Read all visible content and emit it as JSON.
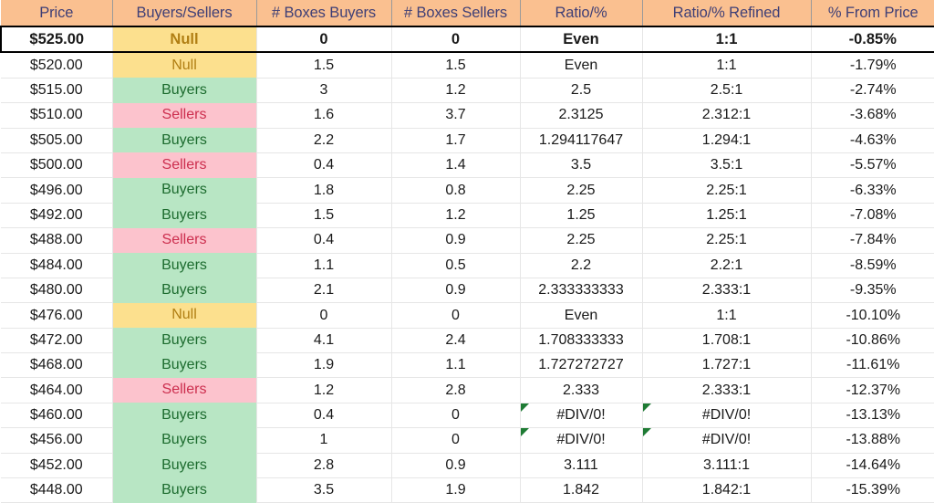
{
  "table": {
    "columns": [
      "Price",
      "Buyers/Sellers",
      "# Boxes Buyers",
      "# Boxes Sellers",
      "Ratio/%",
      "Ratio/% Refined",
      "% From Price"
    ],
    "rows": [
      {
        "price": "$525.00",
        "signal": "Null",
        "boxes_buyers": "0",
        "boxes_sellers": "0",
        "ratio": "Even",
        "ratio_refined": "1:1",
        "pct_from_price": "-0.85%",
        "highlight": true,
        "ratio_error": false
      },
      {
        "price": "$520.00",
        "signal": "Null",
        "boxes_buyers": "1.5",
        "boxes_sellers": "1.5",
        "ratio": "Even",
        "ratio_refined": "1:1",
        "pct_from_price": "-1.79%",
        "highlight": false,
        "ratio_error": false
      },
      {
        "price": "$515.00",
        "signal": "Buyers",
        "boxes_buyers": "3",
        "boxes_sellers": "1.2",
        "ratio": "2.5",
        "ratio_refined": "2.5:1",
        "pct_from_price": "-2.74%",
        "highlight": false,
        "ratio_error": false
      },
      {
        "price": "$510.00",
        "signal": "Sellers",
        "boxes_buyers": "1.6",
        "boxes_sellers": "3.7",
        "ratio": "2.3125",
        "ratio_refined": "2.312:1",
        "pct_from_price": "-3.68%",
        "highlight": false,
        "ratio_error": false
      },
      {
        "price": "$505.00",
        "signal": "Buyers",
        "boxes_buyers": "2.2",
        "boxes_sellers": "1.7",
        "ratio": "1.294117647",
        "ratio_refined": "1.294:1",
        "pct_from_price": "-4.63%",
        "highlight": false,
        "ratio_error": false
      },
      {
        "price": "$500.00",
        "signal": "Sellers",
        "boxes_buyers": "0.4",
        "boxes_sellers": "1.4",
        "ratio": "3.5",
        "ratio_refined": "3.5:1",
        "pct_from_price": "-5.57%",
        "highlight": false,
        "ratio_error": false
      },
      {
        "price": "$496.00",
        "signal": "Buyers",
        "boxes_buyers": "1.8",
        "boxes_sellers": "0.8",
        "ratio": "2.25",
        "ratio_refined": "2.25:1",
        "pct_from_price": "-6.33%",
        "highlight": false,
        "ratio_error": false
      },
      {
        "price": "$492.00",
        "signal": "Buyers",
        "boxes_buyers": "1.5",
        "boxes_sellers": "1.2",
        "ratio": "1.25",
        "ratio_refined": "1.25:1",
        "pct_from_price": "-7.08%",
        "highlight": false,
        "ratio_error": false
      },
      {
        "price": "$488.00",
        "signal": "Sellers",
        "boxes_buyers": "0.4",
        "boxes_sellers": "0.9",
        "ratio": "2.25",
        "ratio_refined": "2.25:1",
        "pct_from_price": "-7.84%",
        "highlight": false,
        "ratio_error": false
      },
      {
        "price": "$484.00",
        "signal": "Buyers",
        "boxes_buyers": "1.1",
        "boxes_sellers": "0.5",
        "ratio": "2.2",
        "ratio_refined": "2.2:1",
        "pct_from_price": "-8.59%",
        "highlight": false,
        "ratio_error": false
      },
      {
        "price": "$480.00",
        "signal": "Buyers",
        "boxes_buyers": "2.1",
        "boxes_sellers": "0.9",
        "ratio": "2.333333333",
        "ratio_refined": "2.333:1",
        "pct_from_price": "-9.35%",
        "highlight": false,
        "ratio_error": false
      },
      {
        "price": "$476.00",
        "signal": "Null",
        "boxes_buyers": "0",
        "boxes_sellers": "0",
        "ratio": "Even",
        "ratio_refined": "1:1",
        "pct_from_price": "-10.10%",
        "highlight": false,
        "ratio_error": false
      },
      {
        "price": "$472.00",
        "signal": "Buyers",
        "boxes_buyers": "4.1",
        "boxes_sellers": "2.4",
        "ratio": "1.708333333",
        "ratio_refined": "1.708:1",
        "pct_from_price": "-10.86%",
        "highlight": false,
        "ratio_error": false
      },
      {
        "price": "$468.00",
        "signal": "Buyers",
        "boxes_buyers": "1.9",
        "boxes_sellers": "1.1",
        "ratio": "1.727272727",
        "ratio_refined": "1.727:1",
        "pct_from_price": "-11.61%",
        "highlight": false,
        "ratio_error": false
      },
      {
        "price": "$464.00",
        "signal": "Sellers",
        "boxes_buyers": "1.2",
        "boxes_sellers": "2.8",
        "ratio": "2.333",
        "ratio_refined": "2.333:1",
        "pct_from_price": "-12.37%",
        "highlight": false,
        "ratio_error": false
      },
      {
        "price": "$460.00",
        "signal": "Buyers",
        "boxes_buyers": "0.4",
        "boxes_sellers": "0",
        "ratio": "#DIV/0!",
        "ratio_refined": "#DIV/0!",
        "pct_from_price": "-13.13%",
        "highlight": false,
        "ratio_error": true
      },
      {
        "price": "$456.00",
        "signal": "Buyers",
        "boxes_buyers": "1",
        "boxes_sellers": "0",
        "ratio": "#DIV/0!",
        "ratio_refined": "#DIV/0!",
        "pct_from_price": "-13.88%",
        "highlight": false,
        "ratio_error": true
      },
      {
        "price": "$452.00",
        "signal": "Buyers",
        "boxes_buyers": "2.8",
        "boxes_sellers": "0.9",
        "ratio": "3.111",
        "ratio_refined": "3.111:1",
        "pct_from_price": "-14.64%",
        "highlight": false,
        "ratio_error": false
      },
      {
        "price": "$448.00",
        "signal": "Buyers",
        "boxes_buyers": "3.5",
        "boxes_sellers": "1.9",
        "ratio": "1.842",
        "ratio_refined": "1.842:1",
        "pct_from_price": "-15.39%",
        "highlight": false,
        "ratio_error": false
      }
    ]
  },
  "colors": {
    "header_fill": "#fac090",
    "header_text": "#3f3f76",
    "buyers_fill": "#b8e6c4",
    "buyers_text": "#1c6b2e",
    "sellers_fill": "#fcc3cd",
    "sellers_text": "#cc2e4e",
    "null_fill": "#fce08e",
    "null_text": "#b07e13",
    "error_flag": "#1e7b34",
    "gridline": "#e6e6e6"
  },
  "icons": {
    "error_flag": "error-flag-triangle-icon"
  }
}
